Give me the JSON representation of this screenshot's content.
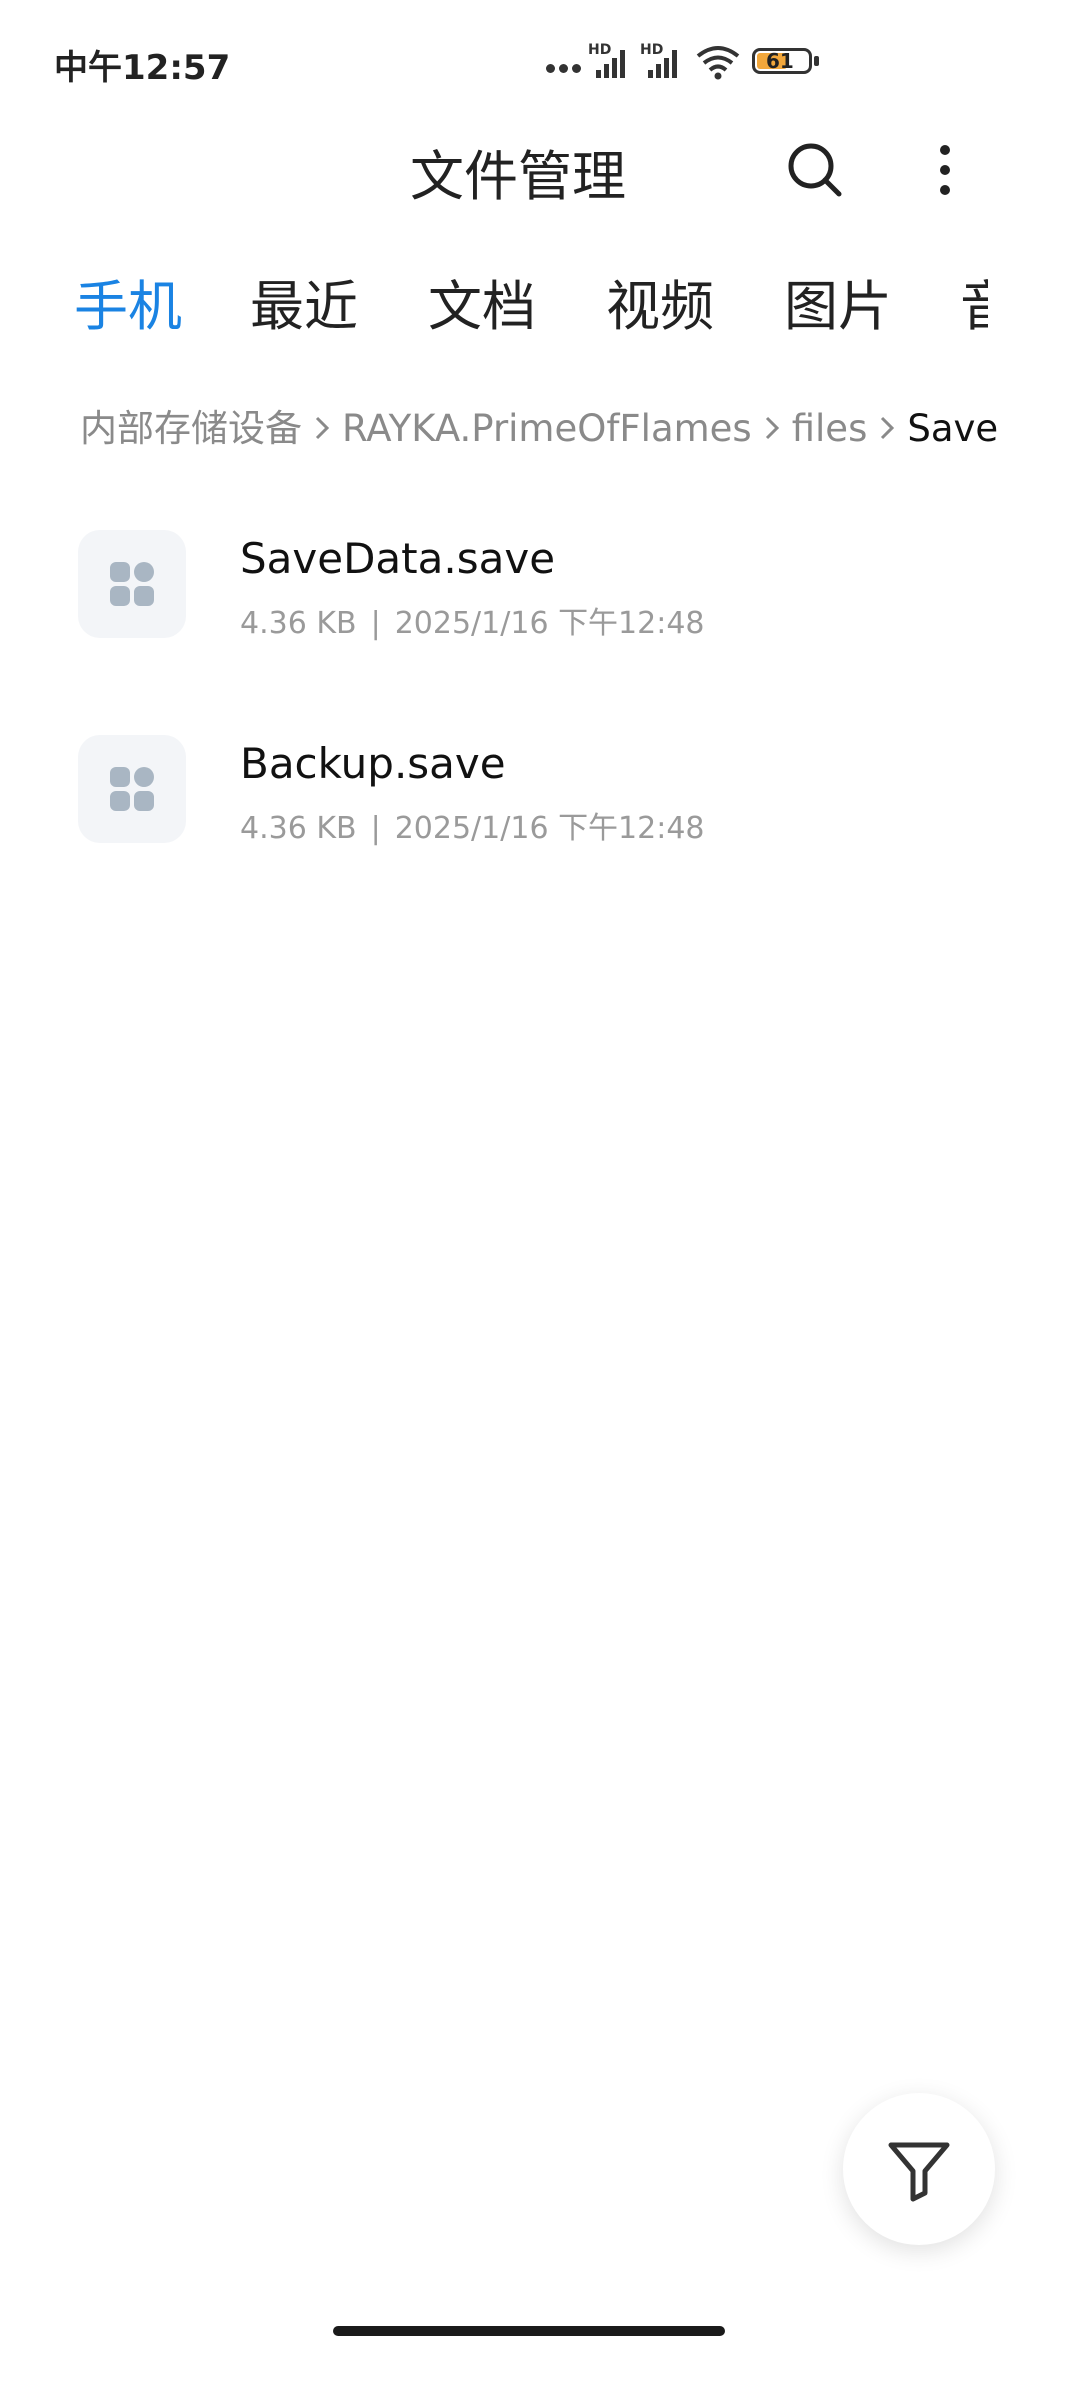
{
  "status_bar": {
    "time": "中午12:57",
    "signal_label_1": "HD",
    "signal_label_2": "HD",
    "battery": "61",
    "icons": [
      "more-dots-icon",
      "signal-hd-icon",
      "signal-hd-icon",
      "wifi-icon",
      "battery-icon"
    ]
  },
  "header": {
    "title": "文件管理",
    "search_icon": "search-icon",
    "more_icon": "more-vertical-icon"
  },
  "tabs": [
    {
      "label": "手机",
      "active": true
    },
    {
      "label": "最近",
      "active": false
    },
    {
      "label": "文档",
      "active": false
    },
    {
      "label": "视频",
      "active": false
    },
    {
      "label": "图片",
      "active": false
    },
    {
      "label": "音",
      "active": false
    }
  ],
  "breadcrumb": {
    "items": [
      "内部存储设备",
      "RAYKA.PrimeOfFlames",
      "files",
      "Save"
    ]
  },
  "files": [
    {
      "name": "SaveData.save",
      "size": "4.36 KB",
      "date": "2025/1/16 下午12:48",
      "icon": "file-grid-icon"
    },
    {
      "name": "Backup.save",
      "size": "4.36 KB",
      "date": "2025/1/16 下午12:48",
      "icon": "file-grid-icon"
    }
  ],
  "meta_separator": "|",
  "fab": {
    "icon": "filter-icon"
  },
  "colors": {
    "accent": "#1a83e3",
    "text": "#111111",
    "muted": "#8a8a8a",
    "icon_fill": "#a9b6c3"
  }
}
